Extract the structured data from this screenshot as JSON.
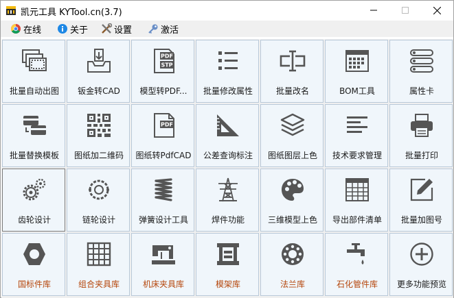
{
  "window": {
    "title": "凯元工具 KYTool.cn(3.7)"
  },
  "menu": [
    {
      "label": "在线",
      "icon": "chrome-icon"
    },
    {
      "label": "关于",
      "icon": "info-icon"
    },
    {
      "label": "设置",
      "icon": "tools-icon"
    },
    {
      "label": "激活",
      "icon": "key-icon"
    }
  ],
  "tools": [
    {
      "label": "批量自动出图",
      "icon": "drawing-sheets-icon"
    },
    {
      "label": "钣金转CAD",
      "icon": "sheet-metal-icon"
    },
    {
      "label": "模型转PDF...",
      "icon": "pdf-stp-icon"
    },
    {
      "label": "批量修改属性",
      "icon": "list-icon"
    },
    {
      "label": "批量改名",
      "icon": "rename-icon"
    },
    {
      "label": "BOM工具",
      "icon": "calendar-table-icon"
    },
    {
      "label": "属性卡",
      "icon": "property-list-icon"
    },
    {
      "label": "批量替换模板",
      "icon": "cards-replace-icon"
    },
    {
      "label": "图纸加二维码",
      "icon": "qr-code-icon"
    },
    {
      "label": "图纸转PdfCAD",
      "icon": "pdf-file-icon"
    },
    {
      "label": "公差查询标注",
      "icon": "set-square-icon"
    },
    {
      "label": "图纸图层上色",
      "icon": "layers-icon"
    },
    {
      "label": "技术要求管理",
      "icon": "text-align-icon"
    },
    {
      "label": "批量打印",
      "icon": "printer-icon"
    },
    {
      "label": "齿轮设计",
      "icon": "gears-icon"
    },
    {
      "label": "链轮设计",
      "icon": "chain-icon"
    },
    {
      "label": "弹簧设计工具",
      "icon": "spring-icon"
    },
    {
      "label": "焊件功能",
      "icon": "tower-icon"
    },
    {
      "label": "三维模型上色",
      "icon": "palette-icon"
    },
    {
      "label": "导出部件清单",
      "icon": "spreadsheet-icon"
    },
    {
      "label": "批量加图号",
      "icon": "edit-icon"
    },
    {
      "label": "国标件库",
      "icon": "hex-nut-icon"
    },
    {
      "label": "组合夹具库",
      "icon": "grid-block-icon"
    },
    {
      "label": "机床夹具库",
      "icon": "sewing-machine-icon"
    },
    {
      "label": "模架库",
      "icon": "mold-frame-icon"
    },
    {
      "label": "法兰库",
      "icon": "flange-icon"
    },
    {
      "label": "石化管件库",
      "icon": "faucet-icon"
    },
    {
      "label": "更多功能预览",
      "icon": "plus-circle-icon"
    }
  ],
  "colors": {
    "icon": "#555555",
    "orange_label": "#b5460b",
    "tile_bg": "#f0f6fb"
  }
}
